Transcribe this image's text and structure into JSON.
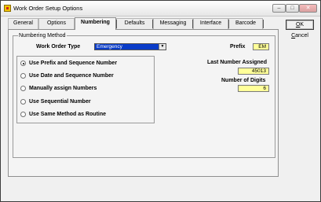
{
  "window": {
    "title": "Work Order Setup Options"
  },
  "titlebar_buttons": {
    "minimize": "–",
    "maximize": "□",
    "close": "✕"
  },
  "tabs": [
    {
      "label": "General",
      "active": false
    },
    {
      "label": "Options",
      "active": false
    },
    {
      "label": "Numbering",
      "active": true
    },
    {
      "label": "Defaults",
      "active": false
    },
    {
      "label": "Messaging",
      "active": false
    },
    {
      "label": "Interface",
      "active": false
    },
    {
      "label": "Barcode",
      "active": false
    }
  ],
  "numbering": {
    "group_title": "Numbering Method",
    "work_order_type_label": "Work Order Type",
    "work_order_type_value": "Emergency",
    "prefix_label": "Prefix",
    "prefix_value": "EM",
    "last_number_label": "Last Number Assigned",
    "last_number_value": "45013",
    "digits_label": "Number of Digits",
    "digits_value": "6",
    "options": [
      {
        "label": "Use Prefix and Sequence Number",
        "selected": true
      },
      {
        "label": "Use Date and Sequence Number",
        "selected": false
      },
      {
        "label": "Manually assign Numbers",
        "selected": false
      },
      {
        "label": "Use Sequential Number",
        "selected": false
      },
      {
        "label": "Use Same Method as Routine",
        "selected": false
      }
    ]
  },
  "buttons": {
    "ok_mnemonic": "O",
    "ok_rest": "K",
    "cancel_mnemonic": "C",
    "cancel_rest": "ancel"
  },
  "colors": {
    "field_highlight": "#ffff99",
    "combo_selection": "#0a3cc8"
  }
}
